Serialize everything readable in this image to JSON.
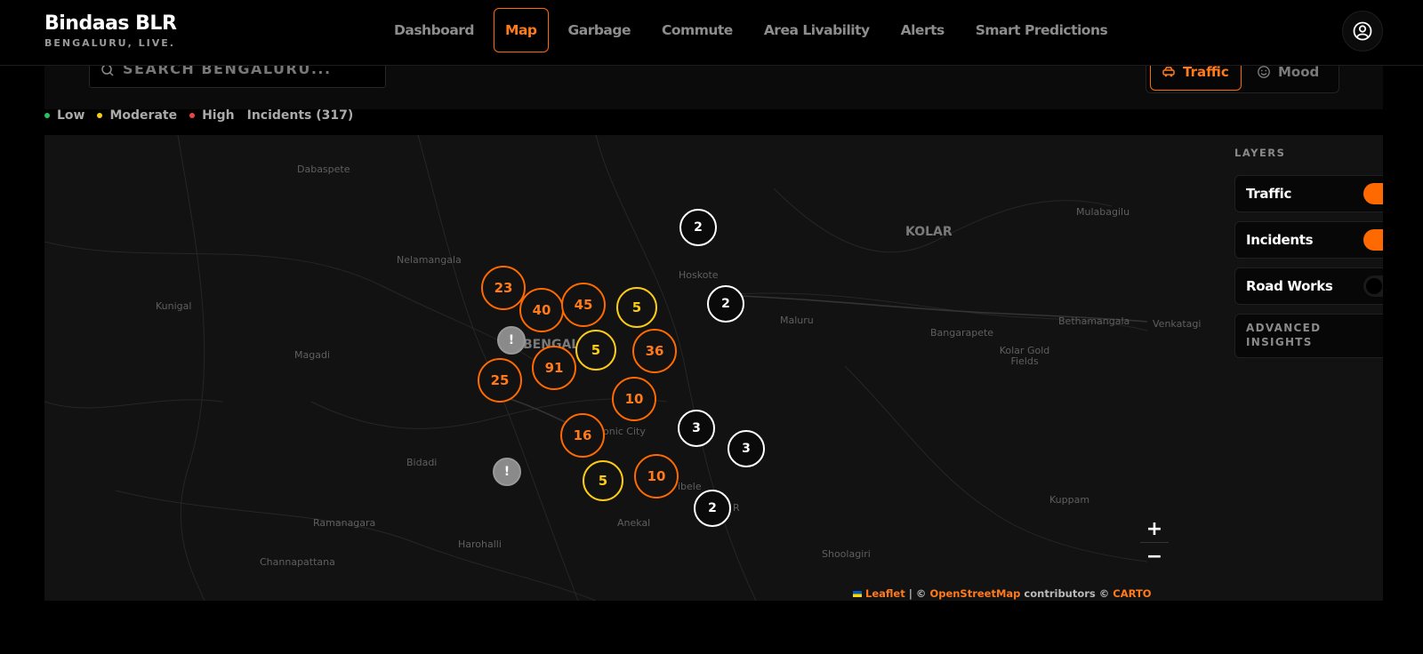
{
  "brand": {
    "title": "Bindaas BLR",
    "subtitle": "BENGALURU, LIVE."
  },
  "nav": {
    "items": [
      {
        "label": "Dashboard"
      },
      {
        "label": "Map",
        "active": true
      },
      {
        "label": "Garbage"
      },
      {
        "label": "Commute"
      },
      {
        "label": "Area Livability"
      },
      {
        "label": "Alerts"
      },
      {
        "label": "Smart Predictions"
      }
    ]
  },
  "search": {
    "placeholder": "SEARCH BENGALURU..."
  },
  "modes": {
    "traffic_label": "Traffic",
    "mood_label": "Mood"
  },
  "legend": {
    "low": "Low",
    "moderate": "Moderate",
    "high": "High",
    "incidents": "Incidents (317)",
    "colors": {
      "low": "#22c55e",
      "moderate": "#facc15",
      "high": "#ef4444"
    }
  },
  "map": {
    "places": {
      "dabaspete": "Dabaspete",
      "nelamangala": "Nelamangala",
      "kunigal": "Kunigal",
      "magadi": "Magadi",
      "bidadi": "Bidadi",
      "ramanagara": "Ramanagara",
      "harohalli": "Harohalli",
      "channapattana": "Channapattana",
      "hoskote": "Hoskote",
      "maluru": "Maluru",
      "kolar": "KOLAR",
      "mulabagilu": "Mulabagilu",
      "bangarapete": "Bangarapete",
      "bethamangala": "Bethamangala",
      "venkatagi": "Venkatagi",
      "kolar_gold_fields": "Kolar Gold Fields",
      "kuppam": "Kuppam",
      "shoolagiri": "Shoolagiri",
      "anekal": "Anekal",
      "electronic_city": "onic City",
      "bengaluru": "BENGALU",
      "hosur": "R",
      "attibele": "ibele"
    },
    "clusters": [
      {
        "count": "23",
        "level": "high"
      },
      {
        "count": "40",
        "level": "high"
      },
      {
        "count": "45",
        "level": "high"
      },
      {
        "count": "5",
        "level": "moderate"
      },
      {
        "count": "5",
        "level": "moderate"
      },
      {
        "count": "36",
        "level": "high"
      },
      {
        "count": "25",
        "level": "high"
      },
      {
        "count": "91",
        "level": "high"
      },
      {
        "count": "10",
        "level": "high"
      },
      {
        "count": "16",
        "level": "high"
      },
      {
        "count": "5",
        "level": "moderate"
      },
      {
        "count": "10",
        "level": "high"
      },
      {
        "count": "2",
        "level": "low"
      },
      {
        "count": "2",
        "level": "low"
      },
      {
        "count": "3",
        "level": "low"
      },
      {
        "count": "3",
        "level": "low"
      },
      {
        "count": "2",
        "level": "low"
      },
      {
        "count": "!",
        "level": "alert"
      },
      {
        "count": "!",
        "level": "alert"
      }
    ],
    "zoom_in": "+",
    "zoom_out": "−",
    "attribution": {
      "leaflet": "Leaflet",
      "sep": " | © ",
      "osm": "OpenStreetMap",
      "contributors": " contributors © ",
      "carto": "CARTO"
    }
  },
  "layers": {
    "title": "LAYERS",
    "items": [
      {
        "label": "Traffic",
        "enabled": true
      },
      {
        "label": "Incidents",
        "enabled": true
      },
      {
        "label": "Road Works",
        "enabled": false
      }
    ],
    "insights_label": "ADVANCED INSIGHTS"
  },
  "colors": {
    "accent": "#ff6a00",
    "moderate": "#facc15",
    "low": "#ffffff",
    "alert": "#888888"
  }
}
